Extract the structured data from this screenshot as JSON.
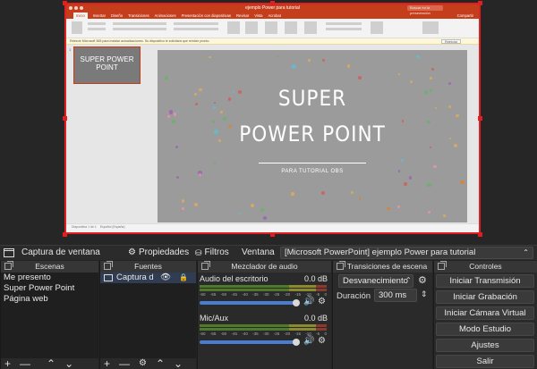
{
  "ppt": {
    "window_title": "ejemplo Power para tutorial",
    "search_placeholder": "Buscar en la presentación",
    "tabs": [
      "Inicio",
      "Insertar",
      "Diseño",
      "Transiciones",
      "Animaciones",
      "Presentación con diapositivas",
      "Revisar",
      "Vista",
      "Acrobat"
    ],
    "share": "Compartir",
    "info_bar": "Reinicie Microsoft 365 para instalar actualizaciones. Su dispositivo le solicitará que reinicie pronto.",
    "info_button": "Reiniciar",
    "thumb_number": "1",
    "thumb_text": "SUPER POWER POINT",
    "slide_title_line1": "SUPER",
    "slide_title_line2": "POWER POINT",
    "slide_subtitle": "PARA TUTORIAL OBS",
    "status_left": "Diapositiva 1 de 1",
    "status_lang": "Español (España)"
  },
  "source_toolbar": {
    "source_name": "Captura de ventana",
    "properties": "Propiedades",
    "filters": "Filtros",
    "window_label": "Ventana",
    "window_value": "[Microsoft PowerPoint] ejemplo Power para tutorial"
  },
  "scenes": {
    "title": "Escenas",
    "items": [
      "Me presento",
      "Super Power Point",
      "Página web"
    ]
  },
  "sources": {
    "title": "Fuentes",
    "items": [
      "Captura d"
    ]
  },
  "mixer": {
    "title": "Mezclador de audio",
    "tracks": [
      {
        "name": "Audio del escritorio",
        "db": "0.0 dB",
        "volume": 1.0
      },
      {
        "name": "Mic/Aux",
        "db": "0.0 dB",
        "volume": 1.0
      }
    ],
    "ticks": [
      "-60",
      "-55",
      "-50",
      "-45",
      "-40",
      "-35",
      "-30",
      "-25",
      "-20",
      "-15",
      "-10",
      "-5",
      "0"
    ]
  },
  "transitions": {
    "title": "Transiciones de escena",
    "transition": "Desvanecimiento",
    "duration_label": "Duración",
    "duration_value": "300 ms"
  },
  "controls": {
    "title": "Controles",
    "buttons": [
      "Iniciar Transmisión",
      "Iniciar Grabación",
      "Iniciar Cámara Virtual",
      "Modo Estudio",
      "Ajustes",
      "Salir"
    ]
  },
  "colors": {
    "accent_red": "#e02020",
    "ppt_brand": "#c43e1c",
    "fader_blue": "#4a7cd0"
  }
}
